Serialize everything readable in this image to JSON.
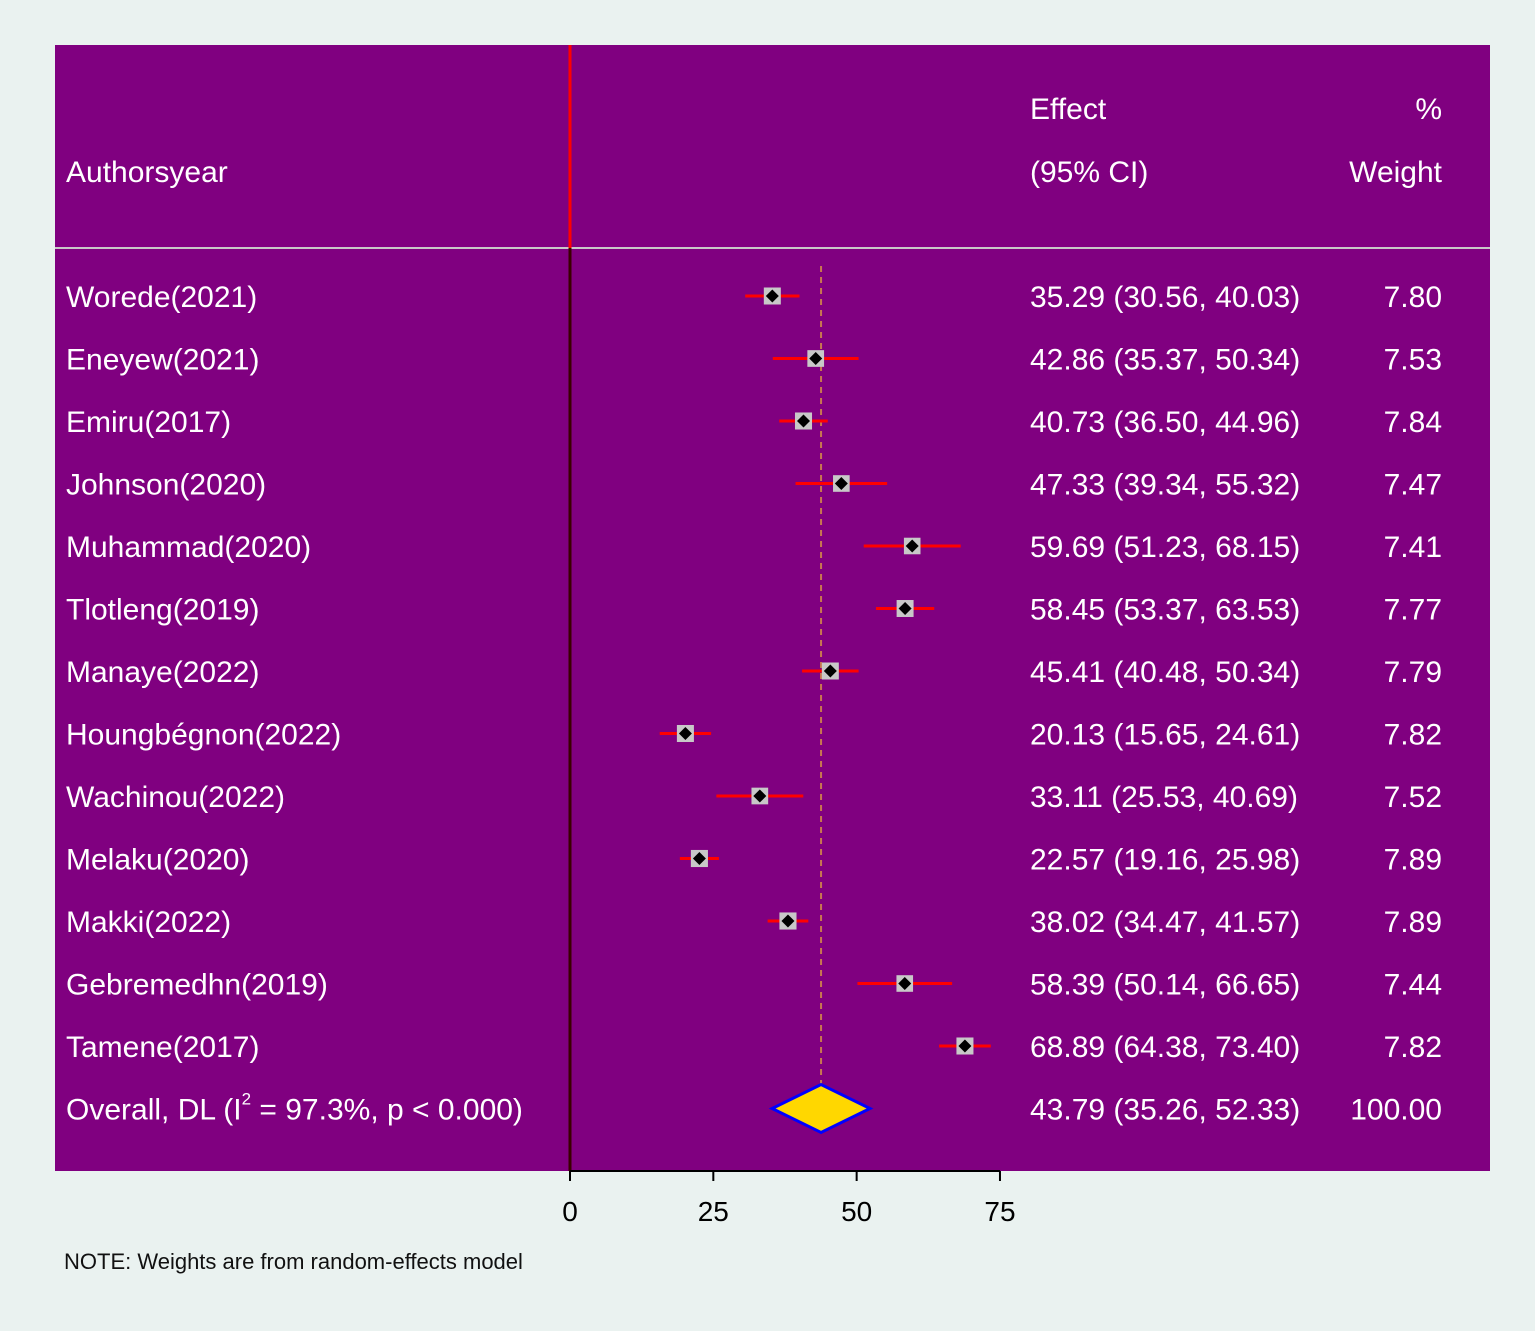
{
  "chart_data": {
    "type": "forest",
    "header": {
      "study_label": "Authorsyear",
      "effect_line1": "Effect",
      "effect_line2": "(95% CI)",
      "weight_line1": "%",
      "weight_line2": "Weight"
    },
    "studies": [
      {
        "label": "Worede(2021)",
        "effect": 35.29,
        "lower": 30.56,
        "upper": 40.03,
        "effect_text": "35.29 (30.56, 40.03)",
        "weight": 7.8,
        "weight_text": "7.80"
      },
      {
        "label": "Eneyew(2021)",
        "effect": 42.86,
        "lower": 35.37,
        "upper": 50.34,
        "effect_text": "42.86 (35.37, 50.34)",
        "weight": 7.53,
        "weight_text": "7.53"
      },
      {
        "label": "Emiru(2017)",
        "effect": 40.73,
        "lower": 36.5,
        "upper": 44.96,
        "effect_text": "40.73 (36.50, 44.96)",
        "weight": 7.84,
        "weight_text": "7.84"
      },
      {
        "label": "Johnson(2020)",
        "effect": 47.33,
        "lower": 39.34,
        "upper": 55.32,
        "effect_text": "47.33 (39.34, 55.32)",
        "weight": 7.47,
        "weight_text": "7.47"
      },
      {
        "label": "Muhammad(2020)",
        "effect": 59.69,
        "lower": 51.23,
        "upper": 68.15,
        "effect_text": "59.69 (51.23, 68.15)",
        "weight": 7.41,
        "weight_text": "7.41"
      },
      {
        "label": "Tlotleng(2019)",
        "effect": 58.45,
        "lower": 53.37,
        "upper": 63.53,
        "effect_text": "58.45 (53.37, 63.53)",
        "weight": 7.77,
        "weight_text": "7.77"
      },
      {
        "label": "Manaye(2022)",
        "effect": 45.41,
        "lower": 40.48,
        "upper": 50.34,
        "effect_text": "45.41 (40.48, 50.34)",
        "weight": 7.79,
        "weight_text": "7.79"
      },
      {
        "label": "Houngbégnon(2022)",
        "effect": 20.13,
        "lower": 15.65,
        "upper": 24.61,
        "effect_text": "20.13 (15.65, 24.61)",
        "weight": 7.82,
        "weight_text": "7.82"
      },
      {
        "label": "Wachinou(2022)",
        "effect": 33.11,
        "lower": 25.53,
        "upper": 40.69,
        "effect_text": "33.11 (25.53, 40.69)",
        "weight": 7.52,
        "weight_text": "7.52"
      },
      {
        "label": "Melaku(2020)",
        "effect": 22.57,
        "lower": 19.16,
        "upper": 25.98,
        "effect_text": "22.57 (19.16, 25.98)",
        "weight": 7.89,
        "weight_text": "7.89"
      },
      {
        "label": "Makki(2022)",
        "effect": 38.02,
        "lower": 34.47,
        "upper": 41.57,
        "effect_text": "38.02 (34.47, 41.57)",
        "weight": 7.89,
        "weight_text": "7.89"
      },
      {
        "label": "Gebremedhn(2019)",
        "effect": 58.39,
        "lower": 50.14,
        "upper": 66.65,
        "effect_text": "58.39 (50.14, 66.65)",
        "weight": 7.44,
        "weight_text": "7.44"
      },
      {
        "label": "Tamene(2017)",
        "effect": 68.89,
        "lower": 64.38,
        "upper": 73.4,
        "effect_text": "68.89 (64.38, 73.40)",
        "weight": 7.82,
        "weight_text": "7.82"
      }
    ],
    "overall": {
      "label_prefix": "Overall, DL (I",
      "label_sup": "2",
      "label_suffix": " = 97.3%, p < 0.000)",
      "effect": 43.79,
      "lower": 35.26,
      "upper": 52.33,
      "effect_text": "43.79 (35.26, 52.33)",
      "weight": 100.0,
      "weight_text": "100.00"
    },
    "x_ticks": [
      0,
      25,
      50,
      75
    ],
    "xlim": [
      0,
      75
    ],
    "null_line": 0,
    "note": "NOTE: Weights are from random-effects model",
    "colors": {
      "background": "#800080",
      "page": "#eaf2f0",
      "ci_line": "#ff0000",
      "null_line": "#ff0000",
      "box": "#c8c8c8",
      "point": "#000000",
      "diamond_fill": "#ffd700",
      "diamond_stroke": "#0000ff",
      "overall_line": "#c87850",
      "text": "#ffffff"
    }
  }
}
